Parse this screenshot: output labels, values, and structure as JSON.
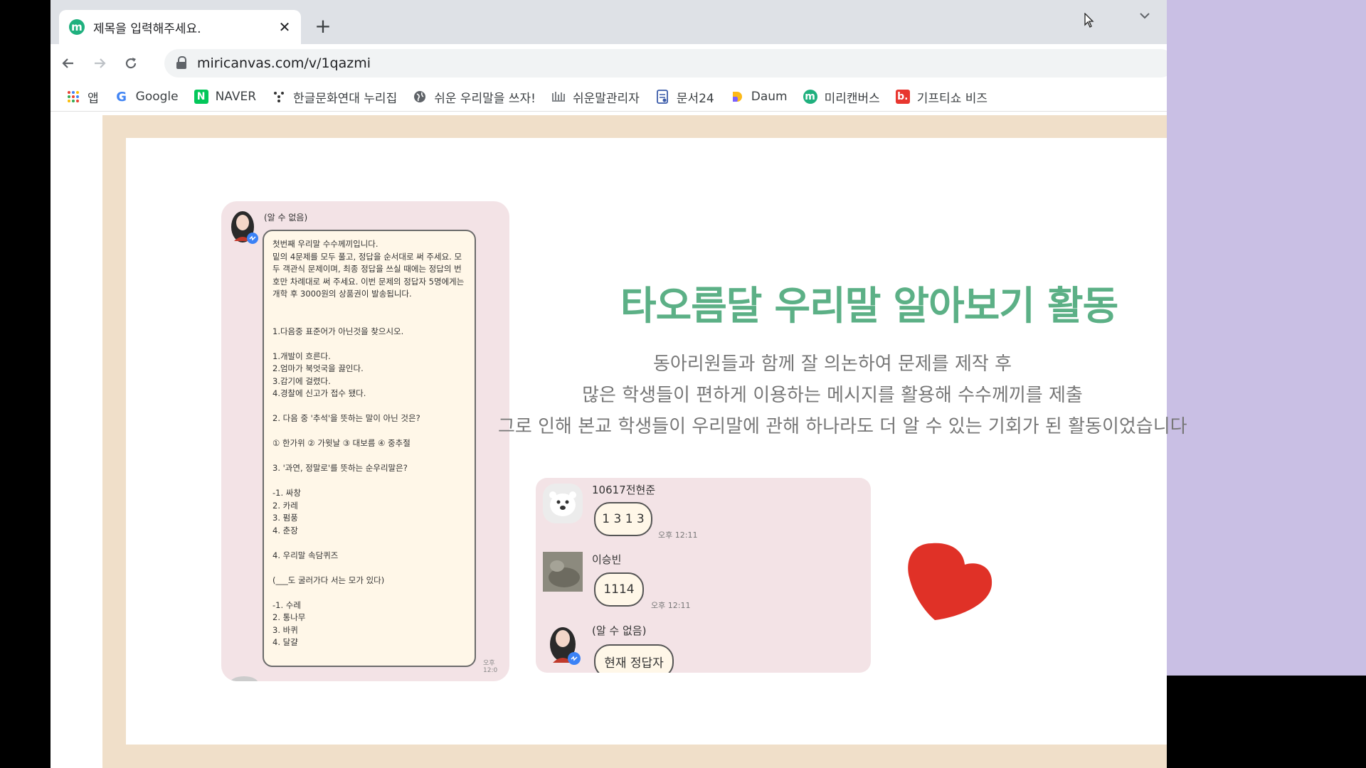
{
  "browser": {
    "tab": {
      "title": "제목을 입력해주세요.",
      "favicon_letter": "m",
      "close_icon": "✕"
    },
    "new_tab_icon": "+",
    "url": "miricanvas.com/v/1qazmi",
    "bookmarks": [
      {
        "label": "앱",
        "icon": "apps-grid-icon"
      },
      {
        "label": "Google",
        "icon": "google-icon"
      },
      {
        "label": "NAVER",
        "icon": "naver-icon"
      },
      {
        "label": "한글문화연대 누리집",
        "icon": "hangeul-culture-icon"
      },
      {
        "label": "쉬운 우리말을 쓰자!",
        "icon": "globe-icon"
      },
      {
        "label": "쉬운말관리자",
        "icon": "easy-words-admin-icon"
      },
      {
        "label": "문서24",
        "icon": "document24-icon"
      },
      {
        "label": "Daum",
        "icon": "daum-icon"
      },
      {
        "label": "미리캔버스",
        "icon": "miricanvas-icon"
      },
      {
        "label": "기프티쇼 비즈",
        "icon": "giftishow-icon"
      }
    ]
  },
  "slide": {
    "title": "타오름달 우리말 알아보기 활동",
    "description": [
      "동아리원들과 함께 잘 의논하여 문제를 제작 후",
      "많은 학생들이 편하게 이용하는 메시지를 활용해 수수께끼를 제출",
      "그로 인해 본교 학생들이 우리말에 관해 하나라도 더 알 수 있는 기회가 된 활동이었습니다"
    ],
    "quiz_chat": {
      "sender": "(알 수 없음)",
      "text": "첫번째 우리말 수수께끼입니다.\n밑의 4문제를 모두 풀고, 정답을 순서대로 써 주세요. 모두 객관식 문제이며, 최종 정답을 쓰실 때에는 정답의 번호만 차례대로 써 주세요. 이번 문제의 정답자 5명에게는 개학 후 3000원의 상품권이 발송됩니다.\n\n\n1.다음중 표준어가 아닌것을 찾으시오.\n\n1.개발이 흐른다.\n2.엄마가 북엇국을 끓인다.\n3.감기에 걸렸다.\n4.경찰에 신고가 접수 됐다.\n\n2. 다음 중 '추석'을 뜻하는 말이 아닌 것은?\n\n① 한가위 ② 가윗날 ③ 대보름 ④ 중추절\n\n3. '과연, 정말로'를 뜻하는 순우리말은?\n\n-1. 싸창\n2. 카레\n3. 펌풍\n4. 춘장\n\n4. 우리말 속담퀴즈\n\n(___도 굴러가다 서는 모가 있다)\n\n-1. 수레\n2. 통나무\n3. 바퀴\n4. 달걀",
      "time": "오후 12:0"
    },
    "reply_chat": [
      {
        "name": "10617전현준",
        "message": "1 3 1 3",
        "time": "오후 12:11"
      },
      {
        "name": "이승빈",
        "message": "1114",
        "time": "오후 12:11"
      },
      {
        "name": "(알 수 없음)",
        "message": "현재 정답자",
        "time": ""
      }
    ]
  },
  "colors": {
    "title_green": "#5cb086",
    "frame_beige": "#f0dfc9",
    "chat_pink": "#f3e3e6",
    "bubble_cream": "#fff7e8",
    "heart_red": "#e03127",
    "side_lavender": "#c9bfe4"
  }
}
